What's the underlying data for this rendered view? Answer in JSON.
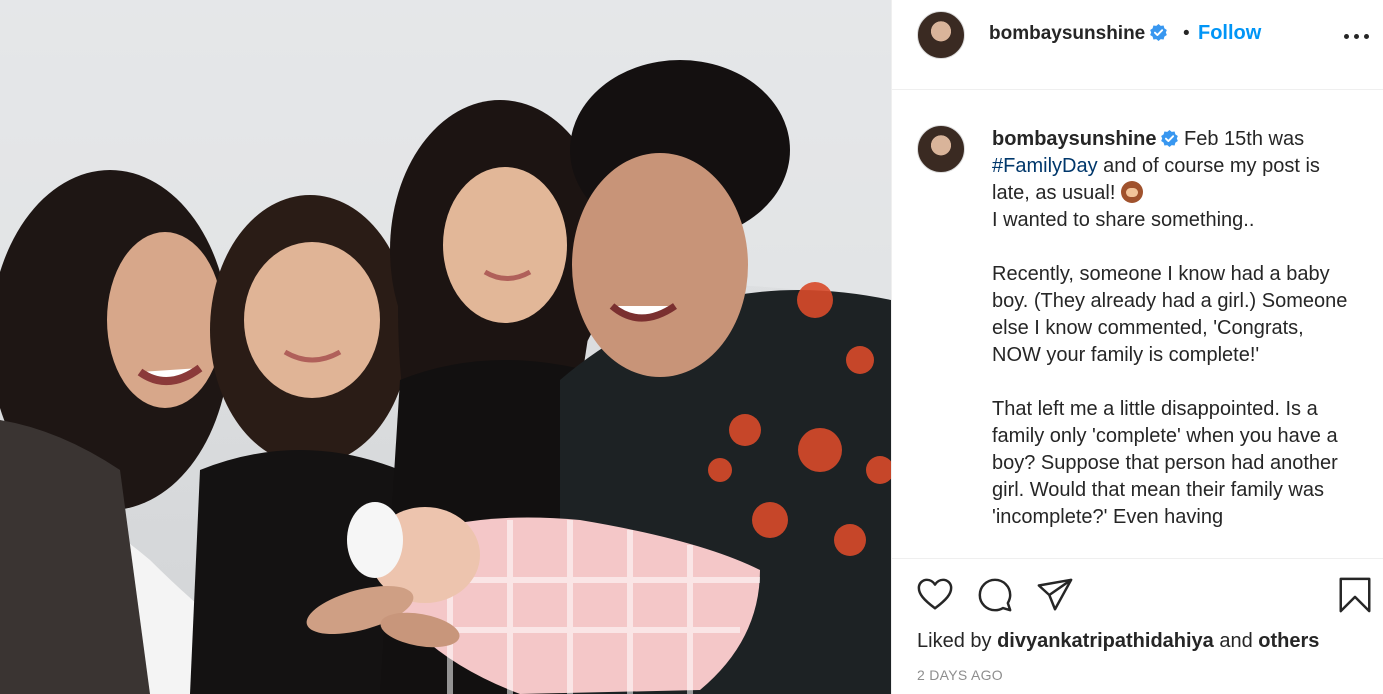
{
  "post": {
    "username": "bombaysunshine",
    "separator": "•",
    "follow_label": "Follow",
    "photo_alt": "Photo by bombaysunshine"
  },
  "caption": {
    "username": "bombaysunshine",
    "text_1": " Feb 15th was ",
    "hashtag": "#FamilyDay",
    "text_2": " and of course my post is late, as usual! ",
    "text_3": "\nI wanted to share something..\n\nRecently, someone I know had a baby boy. (They already had a girl.) Someone else I know commented, 'Congrats, NOW your family is complete!'\n\nThat left me a little disappointed. Is a family only 'complete' when you have a boy? Suppose that person had another girl. Would that mean their family was 'incomplete?' Even having"
  },
  "engagement": {
    "liked_by_prefix": "Liked by ",
    "liked_by_user": "divyankatripathidahiya",
    "liked_by_middle": " and ",
    "liked_by_others": "others",
    "timestamp": "2 DAYS AGO"
  },
  "icons": {
    "verified": "verified-badge-icon",
    "more": "more-options-icon",
    "like": "heart-icon",
    "comment": "comment-icon",
    "share": "share-icon",
    "save": "bookmark-icon",
    "caption_emoji": "see-no-evil-monkey-emoji"
  },
  "colors": {
    "follow": "#0095f6",
    "verified": "#3897f0",
    "hashtag": "#00376b",
    "secondary_text": "#8e8e8e"
  }
}
